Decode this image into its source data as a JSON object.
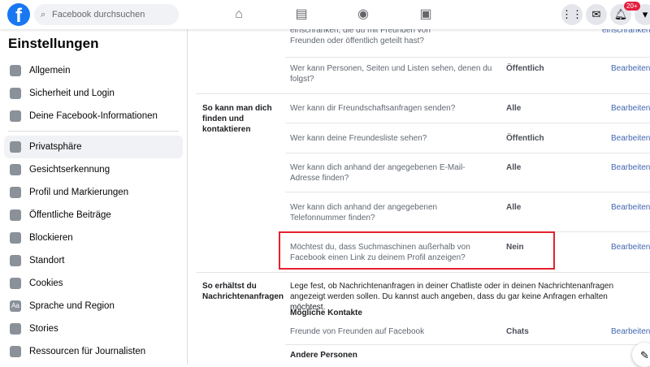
{
  "header": {
    "search_placeholder": "Facebook durchsuchen",
    "notifications_badge": "20+"
  },
  "sidebar": {
    "title": "Einstellungen",
    "items": [
      {
        "label": "Allgemein",
        "icon": "gear-icon"
      },
      {
        "label": "Sicherheit und Login",
        "icon": "shield-icon"
      },
      {
        "label": "Deine Facebook-Informationen",
        "icon": "grid-icon"
      },
      {
        "label": "Privatsphäre",
        "icon": "lock-person-icon"
      },
      {
        "label": "Gesichtserkennung",
        "icon": "face-icon"
      },
      {
        "label": "Profil und Markierungen",
        "icon": "tag-icon"
      },
      {
        "label": "Öffentliche Beiträge",
        "icon": "globe-icon"
      },
      {
        "label": "Blockieren",
        "icon": "block-user-icon"
      },
      {
        "label": "Standort",
        "icon": "location-icon"
      },
      {
        "label": "Cookies",
        "icon": "cookie-icon"
      },
      {
        "label": "Sprache und Region",
        "icon": "language-icon"
      },
      {
        "label": "Stories",
        "icon": "book-icon"
      },
      {
        "label": "Ressourcen für Journalisten",
        "icon": "journalist-icon"
      }
    ]
  },
  "main": {
    "top_row": {
      "question_line1": "einschränken, die du mit Freunden von",
      "question_line2": "Freunden oder öffentlich geteilt hast?",
      "edit": "einschränken"
    },
    "follow_row": {
      "question": "Wer kann Personen, Seiten und Listen sehen, denen du folgst?",
      "value": "Öffentlich",
      "edit": "Bearbeiten"
    },
    "section_find": {
      "title": "So kann man dich finden und kontaktieren",
      "rows": [
        {
          "question": "Wer kann dir Freundschaftsanfragen senden?",
          "value": "Alle",
          "edit": "Bearbeiten"
        },
        {
          "question": "Wer kann deine Freundesliste sehen?",
          "value": "Öffentlich",
          "edit": "Bearbeiten"
        },
        {
          "question": "Wer kann dich anhand der angegebenen E-Mail-Adresse finden?",
          "value": "Alle",
          "edit": "Bearbeiten"
        },
        {
          "question": "Wer kann dich anhand der angegebenen Telefonnummer finden?",
          "value": "Alle",
          "edit": "Bearbeiten"
        },
        {
          "question": "Möchtest du, dass Suchmaschinen außerhalb von Facebook einen Link zu deinem Profil anzeigen?",
          "value": "Nein",
          "edit": "Bearbeiten"
        }
      ]
    },
    "section_messages": {
      "title": "So erhältst du Nachrichtenanfragen",
      "description": "Lege fest, ob Nachrichtenanfragen in deiner Chatliste oder in deinen Nachrichtenanfragen angezeigt werden sollen. Du kannst auch angeben, dass du gar keine Anfragen erhalten möchtest.",
      "subheading": "Mögliche Kontakte",
      "row": {
        "question": "Freunde von Freunden auf Facebook",
        "value": "Chats",
        "edit": "Bearbeiten"
      },
      "subheading2": "Andere Personen"
    }
  }
}
